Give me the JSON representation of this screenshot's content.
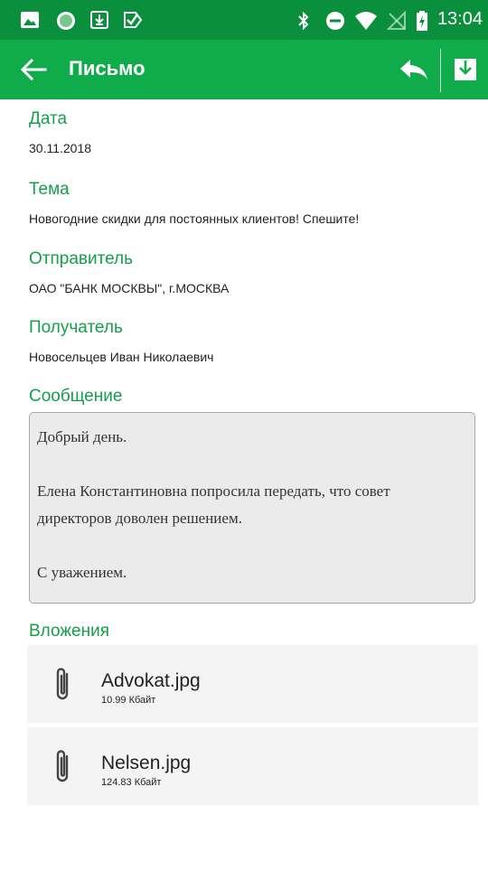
{
  "status_bar": {
    "time": "13:04",
    "icons": [
      "image-icon",
      "green-circle-icon",
      "download-box-icon",
      "checkmark-box-icon",
      "bluetooth-icon",
      "do-not-disturb-icon",
      "wifi-icon",
      "no-sim-icon",
      "battery-charging-icon"
    ]
  },
  "app_bar": {
    "title": "Письмо",
    "back_icon": "arrow-left-icon",
    "reply_icon": "reply-icon",
    "download_icon": "download-icon"
  },
  "letter": {
    "date_label": "Дата",
    "date_value": "30.11.2018",
    "subject_label": "Тема",
    "subject_value": "Новогодние скидки для постоянных клиентов! Спешите!",
    "sender_label": "Отправитель",
    "sender_value": "ОАО \"БАНК МОСКВЫ\", г.МОСКВА",
    "recipient_label": "Получатель",
    "recipient_value": "Новосельцев Иван Николаевич",
    "message_label": "Сообщение",
    "message_lines": [
      "Добрый день.",
      "",
      "Елена Константиновна попросила передать, что совет",
      "директоров доволен решением.",
      "",
      "С уважением."
    ]
  },
  "attachments": {
    "label": "Вложения",
    "items": [
      {
        "name": "Advokat.jpg",
        "size": "10.99 Кбайт",
        "icon": "paperclip-icon"
      },
      {
        "name": "Nelsen.jpg",
        "size": "124.83 Кбайт",
        "icon": "paperclip-icon"
      }
    ]
  },
  "colors": {
    "status_bar": "#0a8f3d",
    "app_bar": "#10ab4a",
    "accent_label": "#15a04a"
  }
}
